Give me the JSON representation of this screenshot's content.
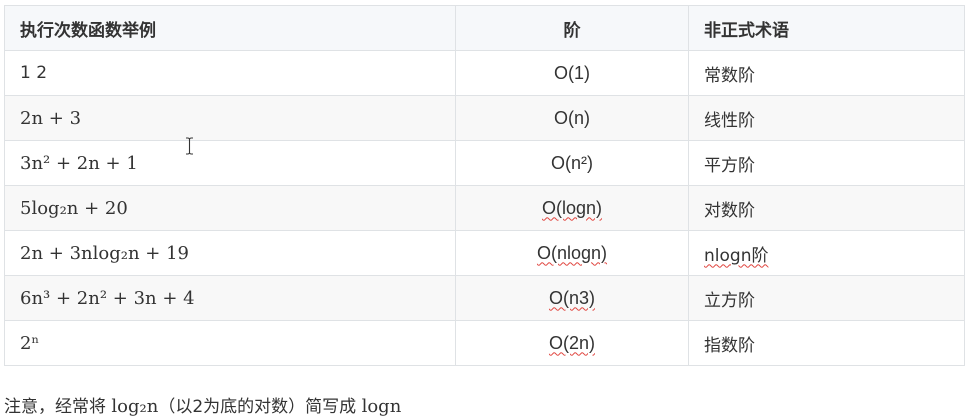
{
  "table": {
    "headers": {
      "example": "执行次数函数举例",
      "order": "阶",
      "term": "非正式术语"
    },
    "rows": [
      {
        "example": "1 2",
        "order": "O(1)",
        "term": "常数阶"
      },
      {
        "example": "2n + 3",
        "order": "O(n)",
        "term": "线性阶"
      },
      {
        "example": "3n² + 2n + 1",
        "order": "O(n²)",
        "term": "平方阶"
      },
      {
        "example": "5log₂n + 20",
        "order": "O(logn)",
        "term": "对数阶"
      },
      {
        "example": "2n + 3nlog₂n + 19",
        "order": "O(nlogn)",
        "term": "nlogn阶"
      },
      {
        "example": "6n³ + 2n² + 3n + 4",
        "order": "O(n3)",
        "term": "立方阶"
      },
      {
        "example": "2ⁿ",
        "order": "O(2n)",
        "term": "指数阶"
      }
    ]
  },
  "note": {
    "prefix": "注意，经常将 ",
    "formula": "log₂n",
    "middle": "（以2为底的对数）简写成 ",
    "short": "logn"
  },
  "colors": {
    "header_bg": "#f6f8fa",
    "stripe_bg": "#f8f8f8",
    "border": "#dfe2e5",
    "text": "#333333",
    "spellcheck_underline": "#e0443e"
  },
  "icons": {
    "cursor": "text-cursor-icon"
  }
}
